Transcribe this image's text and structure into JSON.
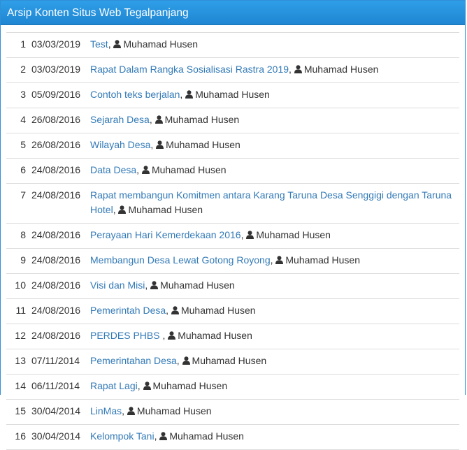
{
  "header": {
    "title": "Arsip Konten Situs Web Tegalpanjang"
  },
  "icons": {
    "author": "user-icon"
  },
  "posts": [
    {
      "no": "1",
      "date": "03/03/2019",
      "title": "Test",
      "author": "Muhamad Husen"
    },
    {
      "no": "2",
      "date": "03/03/2019",
      "title": "Rapat Dalam Rangka Sosialisasi Rastra 2019",
      "author": "Muhamad Husen"
    },
    {
      "no": "3",
      "date": "05/09/2016",
      "title": "Contoh teks berjalan",
      "author": "Muhamad Husen"
    },
    {
      "no": "4",
      "date": "26/08/2016",
      "title": "Sejarah Desa",
      "author": "Muhamad Husen"
    },
    {
      "no": "5",
      "date": "26/08/2016",
      "title": "Wilayah Desa",
      "author": "Muhamad Husen"
    },
    {
      "no": "6",
      "date": "24/08/2016",
      "title": "Data Desa",
      "author": "Muhamad Husen"
    },
    {
      "no": "7",
      "date": "24/08/2016",
      "title": "Rapat membangun Komitmen antara Karang Taruna Desa Senggigi dengan Taruna Hotel",
      "author": "Muhamad Husen"
    },
    {
      "no": "8",
      "date": "24/08/2016",
      "title": "Perayaan Hari Kemerdekaan 2016",
      "author": "Muhamad Husen"
    },
    {
      "no": "9",
      "date": "24/08/2016",
      "title": "Membangun Desa Lewat Gotong Royong",
      "author": "Muhamad Husen"
    },
    {
      "no": "10",
      "date": "24/08/2016",
      "title": "Visi dan Misi",
      "author": "Muhamad Husen"
    },
    {
      "no": "11",
      "date": "24/08/2016",
      "title": "Pemerintah Desa",
      "author": "Muhamad Husen"
    },
    {
      "no": "12",
      "date": "24/08/2016",
      "title": "PERDES PHBS ",
      "author": "Muhamad Husen"
    },
    {
      "no": "13",
      "date": "07/11/2014",
      "title": "Pemerintahan Desa",
      "author": "Muhamad Husen"
    },
    {
      "no": "14",
      "date": "06/11/2014",
      "title": "Rapat Lagi",
      "author": "Muhamad Husen"
    },
    {
      "no": "15",
      "date": "30/04/2014",
      "title": "LinMas",
      "author": "Muhamad Husen"
    },
    {
      "no": "16",
      "date": "30/04/2014",
      "title": "Kelompok Tani",
      "author": "Muhamad Husen"
    }
  ]
}
